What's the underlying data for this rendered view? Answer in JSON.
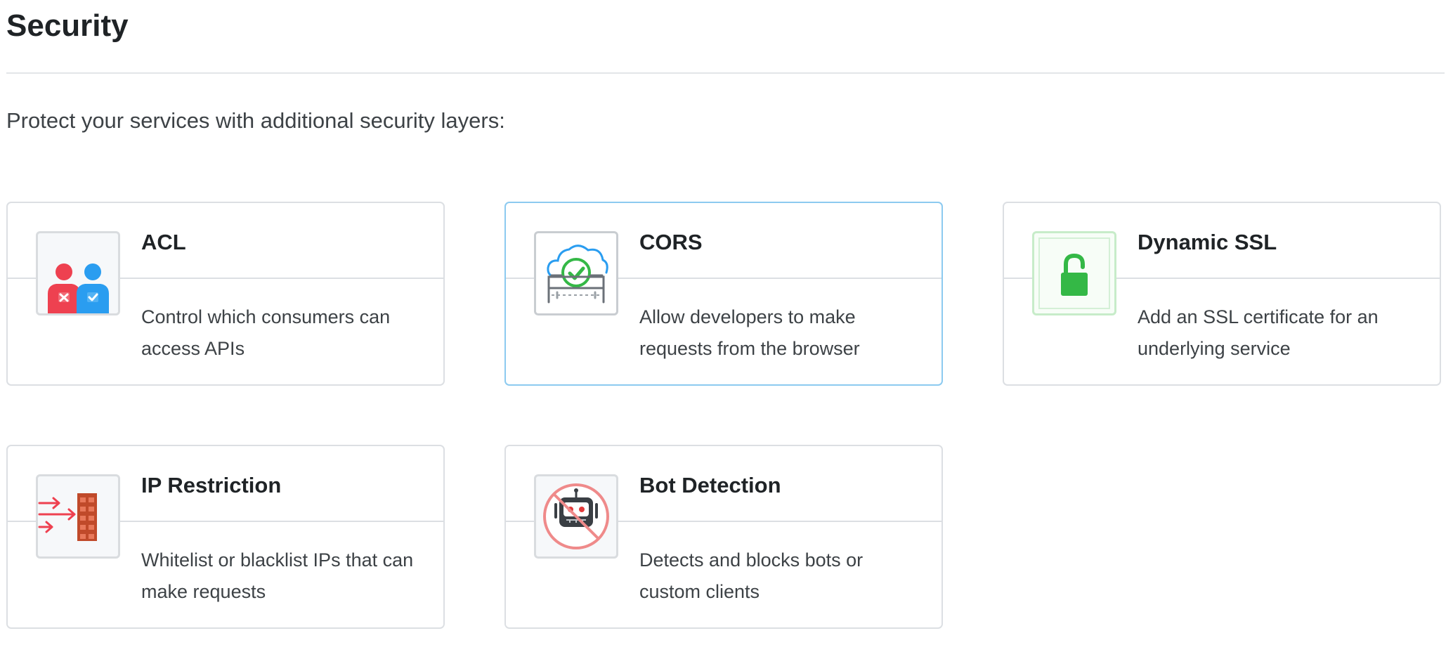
{
  "page": {
    "title": "Security",
    "intro": "Protect your services with additional security layers:"
  },
  "cards": [
    {
      "title": "ACL",
      "description": "Control which consumers can access APIs",
      "icon": "acl-users-icon",
      "selected": false
    },
    {
      "title": "CORS",
      "description": "Allow developers to make requests from the browser",
      "icon": "cors-cloud-check-icon",
      "selected": true
    },
    {
      "title": "Dynamic SSL",
      "description": "Add an SSL certificate for an underlying service",
      "icon": "ssl-padlock-icon",
      "selected": false
    },
    {
      "title": "IP Restriction",
      "description": "Whitelist or blacklist IPs that can make requests",
      "icon": "firewall-icon",
      "selected": false
    },
    {
      "title": "Bot Detection",
      "description": "Detects and blocks bots or custom clients",
      "icon": "blocked-bot-icon",
      "selected": false
    }
  ],
  "colors": {
    "selected_border": "#8ccaf0",
    "card_border": "#dcdfe3",
    "ssl_green": "#34b846",
    "acl_red": "#ee4150",
    "acl_blue": "#2a9df0"
  }
}
